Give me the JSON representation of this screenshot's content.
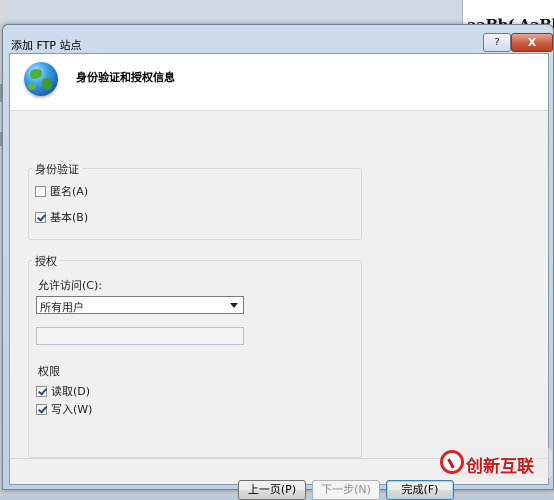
{
  "background": {
    "document_text": "aaBb( AaBb("
  },
  "dialog": {
    "title": "添加 FTP 站点",
    "help_label": "?",
    "close_label": "X",
    "header_title": "身份验证和授权信息",
    "globe_icon": "globe-icon"
  },
  "authentication": {
    "title": "身份验证",
    "anonymous_label": "匿名(A)",
    "anonymous_checked": false,
    "basic_label": "基本(B)",
    "basic_checked": true
  },
  "authorization": {
    "title": "授权",
    "allow_access_label": "允许访问(C):",
    "allow_access_value": "所有用户",
    "user_textbox_value": "",
    "permissions_title": "权限",
    "read_label": "读取(D)",
    "read_checked": true,
    "write_label": "写入(W)",
    "write_checked": true
  },
  "buttons": {
    "previous": "上一页(P)",
    "next": "下一步(N)",
    "finish": "完成(F)"
  },
  "watermark": {
    "text": "创新互联"
  }
}
